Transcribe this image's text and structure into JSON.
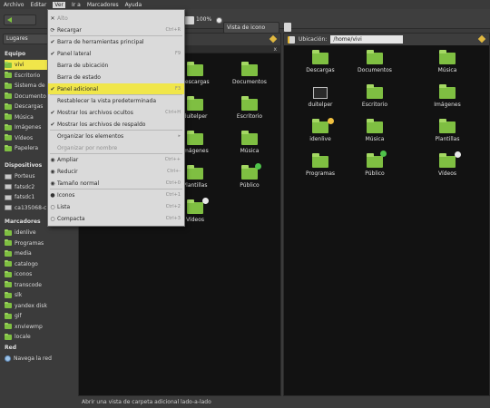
{
  "menubar": {
    "items": [
      "Archivo",
      "Editar",
      "Ver",
      "Ir a",
      "Marcadores",
      "Ayuda"
    ]
  },
  "toolbar": {
    "zoom_label": "100%",
    "view_mode": "Vista de icono"
  },
  "sidebar": {
    "places_label": "Lugares",
    "equipo_header": "Equipo",
    "equipo_items": [
      "vivi",
      "Escritorio",
      "Sistema de",
      "Documento",
      "Descargas",
      "Música",
      "Imágenes",
      "Vídeos",
      "Papelera"
    ],
    "dispositivos_header": "Dispositivos",
    "dispositivos_items": [
      "Porteus",
      "fatsdc2",
      "fatsdc1",
      "ca135068-c"
    ],
    "marcadores_header": "Marcadores",
    "marcadores_items": [
      "idenlive",
      "Programas",
      "media",
      "catalogo",
      "iconos",
      "transcode",
      "slk",
      "yandex disk",
      "gif",
      "xnviewmp",
      "locale"
    ],
    "red_header": "Red",
    "red_items": [
      "Navega la red"
    ]
  },
  "view_menu": {
    "items": [
      {
        "label": "Alto",
        "accel": "",
        "mark": "stop",
        "disabled": true
      },
      {
        "label": "Recargar",
        "accel": "Ctrl+R",
        "mark": "reload",
        "disabled": false
      },
      {
        "label": "Barra de herramientas principal",
        "accel": "",
        "mark": "check",
        "disabled": false
      },
      {
        "label": "Panel lateral",
        "accel": "F9",
        "mark": "check",
        "disabled": false
      },
      {
        "label": "Barra de ubicación",
        "accel": "",
        "mark": "",
        "disabled": false
      },
      {
        "label": "Barra de estado",
        "accel": "",
        "mark": "",
        "disabled": false
      },
      {
        "label": "Panel adicional",
        "accel": "F3",
        "mark": "check",
        "disabled": false
      },
      {
        "label": "Restablecer la vista predeterminada",
        "accel": "",
        "mark": "",
        "disabled": false
      },
      {
        "label": "Mostrar los archivos ocultos",
        "accel": "Ctrl+H",
        "mark": "check",
        "disabled": false
      },
      {
        "label": "Mostrar los archivos de respaldo",
        "accel": "",
        "mark": "check",
        "disabled": false
      },
      {
        "label": "Organizar los elementos",
        "accel": "▸",
        "mark": "",
        "disabled": false
      },
      {
        "label": "Organizar por nombre",
        "accel": "",
        "mark": "",
        "disabled": true
      },
      {
        "label": "Ampliar",
        "accel": "Ctrl++",
        "mark": "zoom",
        "disabled": false
      },
      {
        "label": "Reducir",
        "accel": "Ctrl+-",
        "mark": "zoom",
        "disabled": false
      },
      {
        "label": "Tamaño normal",
        "accel": "Ctrl+0",
        "mark": "zoom",
        "disabled": false
      },
      {
        "label": "Iconos",
        "accel": "Ctrl+1",
        "mark": "dot",
        "disabled": false
      },
      {
        "label": "Lista",
        "accel": "Ctrl+2",
        "mark": "radio",
        "disabled": false
      },
      {
        "label": "Compacta",
        "accel": "Ctrl+3",
        "mark": "radio",
        "disabled": false
      }
    ],
    "highlighted": "Panel adicional"
  },
  "left_panel": {
    "tab_close": "x",
    "items": [
      "Descargas",
      "Documentos",
      "duitelper",
      "Escritorio",
      "Imágenes",
      "Música",
      "Plantillas",
      "Público",
      "Vídeos"
    ]
  },
  "right_panel": {
    "location_label": "Ubicación:",
    "location_value": "/home/vivi",
    "items": [
      "Descargas",
      "Documentos",
      "Música",
      "duitelper",
      "Escritorio",
      "Imágenes",
      "idenlive",
      "Música",
      "Plantillas",
      "Programas",
      "Público",
      "Vídeos"
    ]
  },
  "statusbar": {
    "text": "Abrir una vista de carpeta adicional lado-a-lado"
  }
}
